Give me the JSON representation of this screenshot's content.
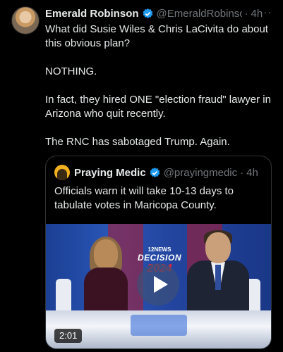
{
  "tweet": {
    "author_name": "Emerald Robinson",
    "author_handle": "@EmeraldRobinson",
    "time": "4h",
    "more_label": "···",
    "paragraphs": [
      "What did Susie Wiles & Chris LaCivita do about this obvious plan?",
      "NOTHING.",
      "In fact, they hired ONE \"election fraud\" lawyer in Arizona who quit recently.",
      "The RNC has sabotaged Trump. Again."
    ]
  },
  "quoted": {
    "author_name": "Praying Medic",
    "author_handle": "@prayingmedic",
    "time": "4h",
    "text": "Officials warn it will take 10-13 days to tabulate votes in Maricopa County.",
    "video": {
      "duration": "2:01",
      "logo_news": "12NEWS",
      "logo_decision": "DECISION",
      "logo_year": "2024"
    }
  },
  "colors": {
    "background": "#000000",
    "text": "#e7e9ea",
    "muted": "#71767b",
    "verified": "#1d9bf0",
    "border": "#2f3336"
  },
  "icons": [
    "avatar",
    "verified-badge-icon",
    "more-icon",
    "play-icon"
  ]
}
